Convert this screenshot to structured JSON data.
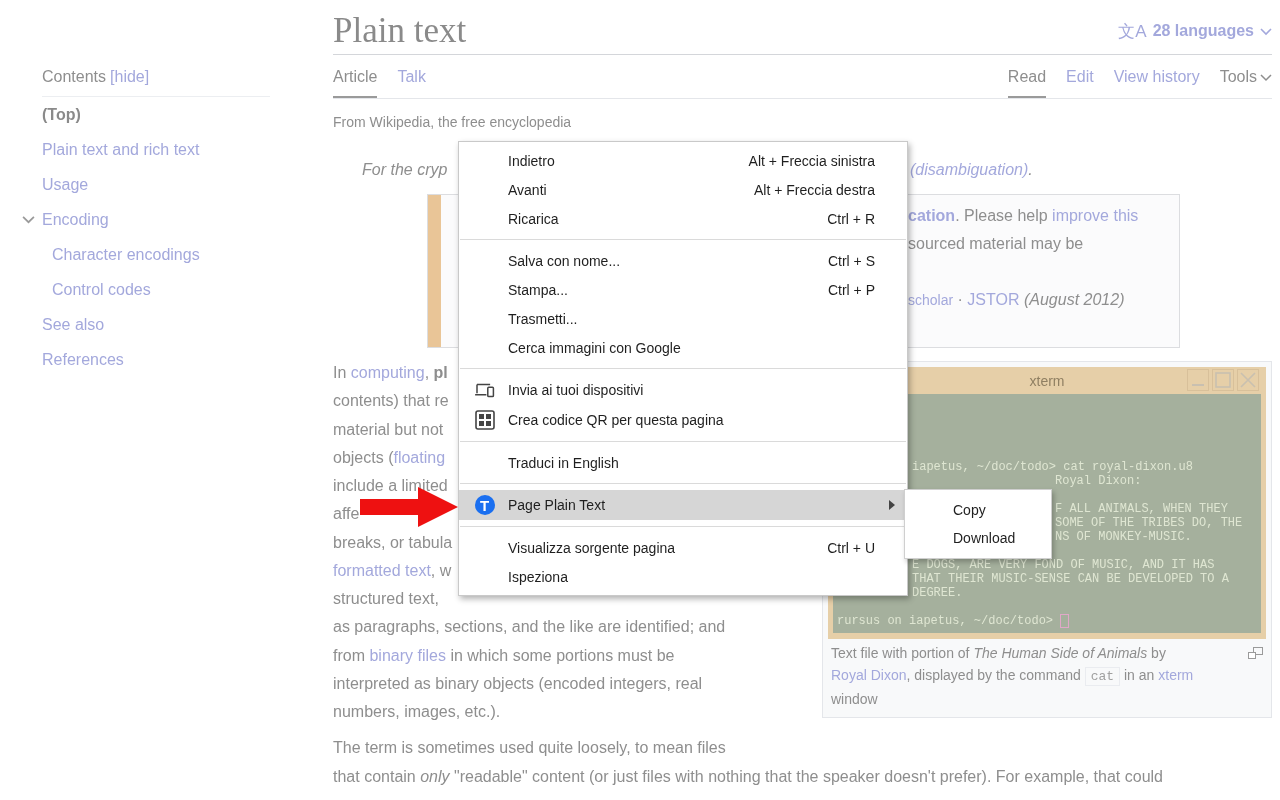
{
  "sidebar": {
    "title": "Contents",
    "toggle": "[hide]",
    "items": [
      {
        "label": "(Top)",
        "selected": true
      },
      {
        "label": "Plain text and rich text",
        "selected": false
      },
      {
        "label": "Usage",
        "selected": false
      },
      {
        "label": "Encoding",
        "selected": false,
        "expanded": true,
        "children": [
          {
            "label": "Character encodings",
            "selected": false
          },
          {
            "label": "Control codes",
            "selected": false
          }
        ]
      },
      {
        "label": "See also",
        "selected": false
      },
      {
        "label": "References",
        "selected": false
      }
    ]
  },
  "header": {
    "title": "Plain text",
    "languages": {
      "icon_text": "文A",
      "label": "28 languages"
    }
  },
  "left_tabs": [
    {
      "label": "Article",
      "selected": true
    },
    {
      "label": "Talk",
      "selected": false
    }
  ],
  "right_tabs": [
    {
      "label": "Read",
      "selected": true,
      "kind": "tab"
    },
    {
      "label": "Edit",
      "selected": false,
      "kind": "tab"
    },
    {
      "label": "View history",
      "selected": false,
      "kind": "tab"
    },
    {
      "label": "Tools",
      "selected": false,
      "kind": "dropdown"
    }
  ],
  "tagline": "From Wikipedia, the free encyclopedia",
  "hatnote": {
    "left": "For the cryp",
    "right": [
      {
        "text": "(disambiguation)",
        "kind": "link-italic"
      },
      {
        "text": ".",
        "kind": "plain"
      }
    ]
  },
  "notice": {
    "paragraphs": [
      [
        [
          {
            "text": "cation",
            "kind": "link-bold"
          },
          {
            "text": ". Please help ",
            "kind": "plain"
          },
          {
            "text": "improve this",
            "kind": "link"
          }
        ],
        [
          {
            "text": "sourced material may be",
            "kind": "plain"
          }
        ]
      ],
      [
        [
          {
            "text": "scholar",
            "kind": "link-small"
          },
          {
            "text": " · ",
            "kind": "plain"
          },
          {
            "text": "JSTOR",
            "kind": "link"
          },
          {
            "text": " (August 2012)",
            "kind": "italic"
          }
        ]
      ]
    ]
  },
  "body_lines": [
    [
      {
        "text": "In ",
        "kind": "plain"
      },
      {
        "text": "computing",
        "kind": "link"
      },
      {
        "text": ", **pl**",
        "kind": "rich"
      }
    ],
    [
      {
        "text": "contents) that re",
        "kind": "plain"
      }
    ],
    [
      {
        "text": "material but not",
        "kind": "plain"
      }
    ],
    [
      {
        "text": "objects (",
        "kind": "plain"
      },
      {
        "text": "floating",
        "kind": "link"
      }
    ],
    [
      {
        "text": "include a limited",
        "kind": "plain"
      }
    ],
    [
      {
        "text": "affe",
        "kind": "plain"
      }
    ],
    [
      {
        "text": "breaks, or tabula",
        "kind": "plain"
      }
    ],
    [
      {
        "text": "formatted text",
        "kind": "link"
      },
      {
        "text": ", w",
        "kind": "plain"
      }
    ],
    [
      {
        "text": "structured text,",
        "kind": "plain"
      }
    ],
    [
      {
        "text": "as paragraphs, sections, and the like are identified; and",
        "kind": "plain"
      }
    ],
    [
      {
        "text": "from ",
        "kind": "plain"
      },
      {
        "text": "binary files",
        "kind": "link"
      },
      {
        "text": " in which some portions must be",
        "kind": "plain"
      }
    ],
    [
      {
        "text": "interpreted as binary objects (encoded integers, real",
        "kind": "plain"
      }
    ],
    [
      {
        "text": "numbers, images, etc.).",
        "kind": "plain"
      }
    ]
  ],
  "figure": {
    "window_title": "xterm",
    "terminal_blocks": [
      [
        {
          "text": "iapetus, ~/doc/todo> cat royal-dixon.u8",
          "kind": "after-menu"
        },
        {
          "text": "Royal Dixon:",
          "kind": "after-submenu"
        }
      ],
      [
        {
          "text": "F ALL ANIMALS, WHEN THEY",
          "kind": "after-submenu"
        },
        {
          "text": "SOME OF THE TRIBES DO, THE",
          "kind": "after-submenu"
        },
        {
          "text": "NS OF MONKEY-MUSIC.",
          "kind": "after-submenu"
        }
      ],
      [
        {
          "text": "E DOGS, ARE VERY FOND OF MUSIC, AND IT HAS",
          "kind": "after-menu"
        },
        {
          "text": "THAT THEIR MUSIC-SENSE CAN BE DEVELOPED TO A",
          "kind": "after-menu"
        },
        {
          "text": "DEGREE.",
          "kind": "after-menu"
        }
      ],
      [
        {
          "text": "rursus on iapetus, ~/doc/todo>",
          "kind": "prompt"
        }
      ]
    ],
    "caption": [
      {
        "text": "Text file with portion of ",
        "kind": "plain"
      },
      {
        "text": "The Human Side of Animals",
        "kind": "italic"
      },
      {
        "text": " by ",
        "kind": "plain"
      },
      {
        "text": "Royal Dixon",
        "kind": "link"
      },
      {
        "text": ", displayed by the command ",
        "kind": "plain"
      },
      {
        "text": "cat",
        "kind": "code"
      },
      {
        "text": " in an ",
        "kind": "plain"
      },
      {
        "text": "xterm",
        "kind": "link"
      },
      {
        "text": " window",
        "kind": "plain"
      }
    ]
  },
  "paragraph_2": [
    [
      {
        "text": "The term is sometimes used quite loosely, to mean files",
        "kind": "plain"
      }
    ],
    [
      {
        "text": "that contain ",
        "kind": "plain"
      },
      {
        "text": "only",
        "kind": "italic"
      },
      {
        "text": " \"readable\" content (or just files with nothing that the speaker doesn't prefer). For example, that could",
        "kind": "plain"
      }
    ]
  ],
  "context_menu": {
    "groups": [
      [
        {
          "label": "Indietro",
          "shortcut": "Alt + Freccia sinistra",
          "kind": "plain",
          "selected": false,
          "submenu": false
        },
        {
          "label": "Avanti",
          "shortcut": "Alt + Freccia destra",
          "kind": "plain",
          "selected": false,
          "submenu": false
        },
        {
          "label": "Ricarica",
          "shortcut": "Ctrl + R",
          "kind": "plain",
          "selected": false,
          "submenu": false
        }
      ],
      [
        {
          "label": "Salva con nome...",
          "shortcut": "Ctrl + S",
          "kind": "plain",
          "selected": false,
          "submenu": false
        },
        {
          "label": "Stampa...",
          "shortcut": "Ctrl + P",
          "kind": "plain",
          "selected": false,
          "submenu": false
        },
        {
          "label": "Trasmetti...",
          "kind": "plain",
          "selected": false,
          "submenu": false
        },
        {
          "label": "Cerca immagini con Google",
          "kind": "plain",
          "selected": false,
          "submenu": false
        }
      ],
      [
        {
          "label": "Invia ai tuoi dispositivi",
          "kind": "devices",
          "selected": false,
          "submenu": false
        },
        {
          "label": "Crea codice QR per questa pagina",
          "kind": "qrcode",
          "selected": false,
          "submenu": false
        }
      ],
      [
        {
          "label": "Traduci in English",
          "kind": "plain",
          "selected": false,
          "submenu": false
        }
      ],
      [
        {
          "label": "Page Plain Text",
          "kind": "extension",
          "icon_text": "T",
          "selected": true,
          "submenu": true
        }
      ],
      [
        {
          "label": "Visualizza sorgente pagina",
          "shortcut": "Ctrl + U",
          "kind": "plain",
          "selected": false,
          "submenu": false
        },
        {
          "label": "Ispeziona",
          "kind": "plain",
          "selected": false,
          "submenu": false
        }
      ]
    ]
  },
  "submenu": {
    "items": [
      {
        "label": "Copy",
        "selected": false
      },
      {
        "label": "Download",
        "selected": false
      }
    ]
  }
}
